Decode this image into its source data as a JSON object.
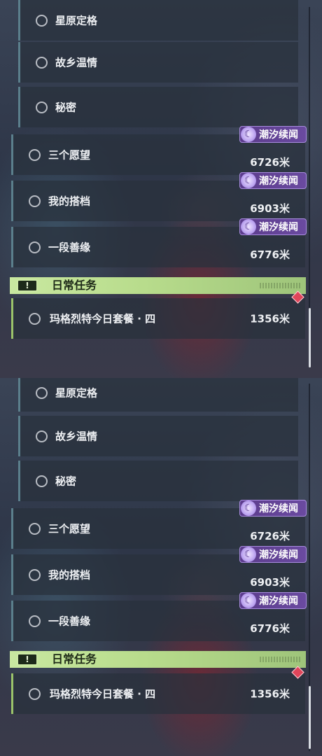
{
  "panels": [
    {
      "sub_quests": [
        {
          "label": "星原定格"
        },
        {
          "label": "故乡温情"
        },
        {
          "label": "秘密"
        }
      ],
      "main_quests": [
        {
          "label": "三个愿望",
          "distance": "6726米",
          "badge": "潮汐续闻"
        },
        {
          "label": "我的搭档",
          "distance": "6903米",
          "badge": "潮汐续闻"
        },
        {
          "label": "一段善缘",
          "distance": "6776米",
          "badge": "潮汐续闻"
        }
      ],
      "daily_header": {
        "icon": "!",
        "title": "日常任务"
      },
      "daily_quest": {
        "label": "玛格烈特今日套餐 · 四",
        "distance": "1356米"
      }
    },
    {
      "sub_quests": [
        {
          "label": "星原定格"
        },
        {
          "label": "故乡温情"
        },
        {
          "label": "秘密"
        }
      ],
      "main_quests": [
        {
          "label": "三个愿望",
          "distance": "6726米",
          "badge": "潮汐续闻"
        },
        {
          "label": "我的搭档",
          "distance": "6903米",
          "badge": "潮汐续闻"
        },
        {
          "label": "一段善缘",
          "distance": "6776米",
          "badge": "潮汐续闻"
        }
      ],
      "daily_header": {
        "icon": "!",
        "title": "日常任务"
      },
      "daily_quest": {
        "label": "玛格烈特今日套餐 · 四",
        "distance": "1356米"
      }
    }
  ],
  "colors": {
    "daily_accent": "#b8dc8c",
    "badge_purple": "#6a4aa0",
    "tracker_marker": "#e0455a"
  },
  "icons": {
    "quest_status": "circle-outline-icon",
    "badge": "tide-swirl-icon",
    "daily": "exclamation-icon",
    "tracked": "diamond-marker-icon"
  }
}
